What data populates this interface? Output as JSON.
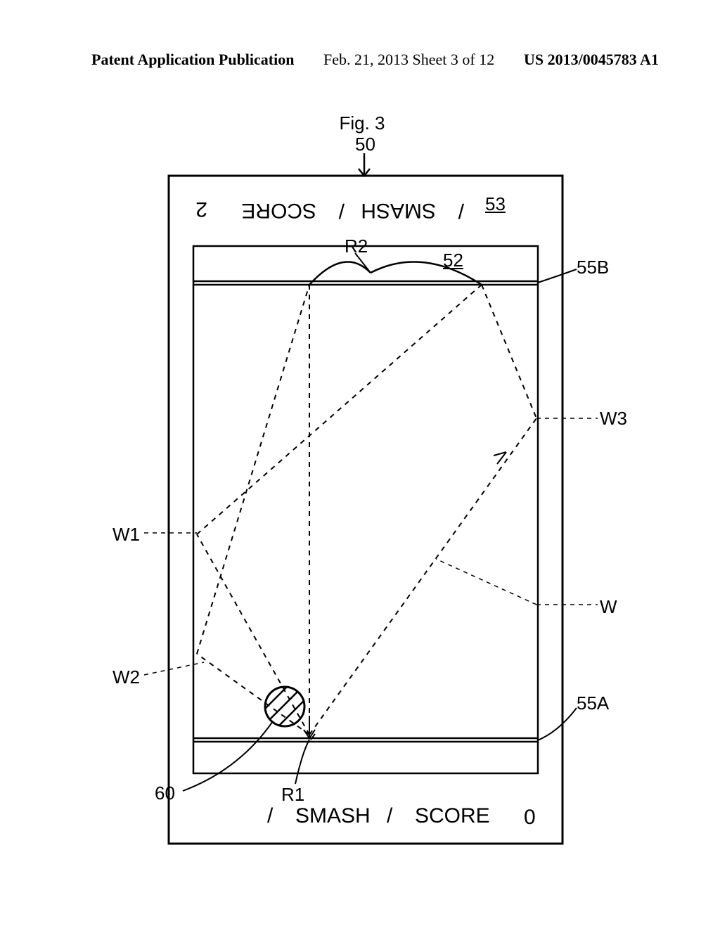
{
  "header": {
    "left": "Patent Application Publication",
    "mid": "Feb. 21, 2013  Sheet 3 of 12",
    "right": "US 2013/0045783 A1"
  },
  "figure": {
    "title": "Fig. 3",
    "top_ref": "50",
    "labels": {
      "ref52": "52",
      "ref53": "53",
      "ref55B": "55B",
      "ref55A": "55A",
      "ref60": "60",
      "R1": "R1",
      "R2": "R2",
      "W": "W",
      "W1": "W1",
      "W2": "W2",
      "W3": "W3"
    },
    "scorebar": {
      "smash_label": "SMASH",
      "score_label": "SCORE",
      "sep": "/",
      "top_score": "2",
      "bottom_score": "0"
    }
  }
}
